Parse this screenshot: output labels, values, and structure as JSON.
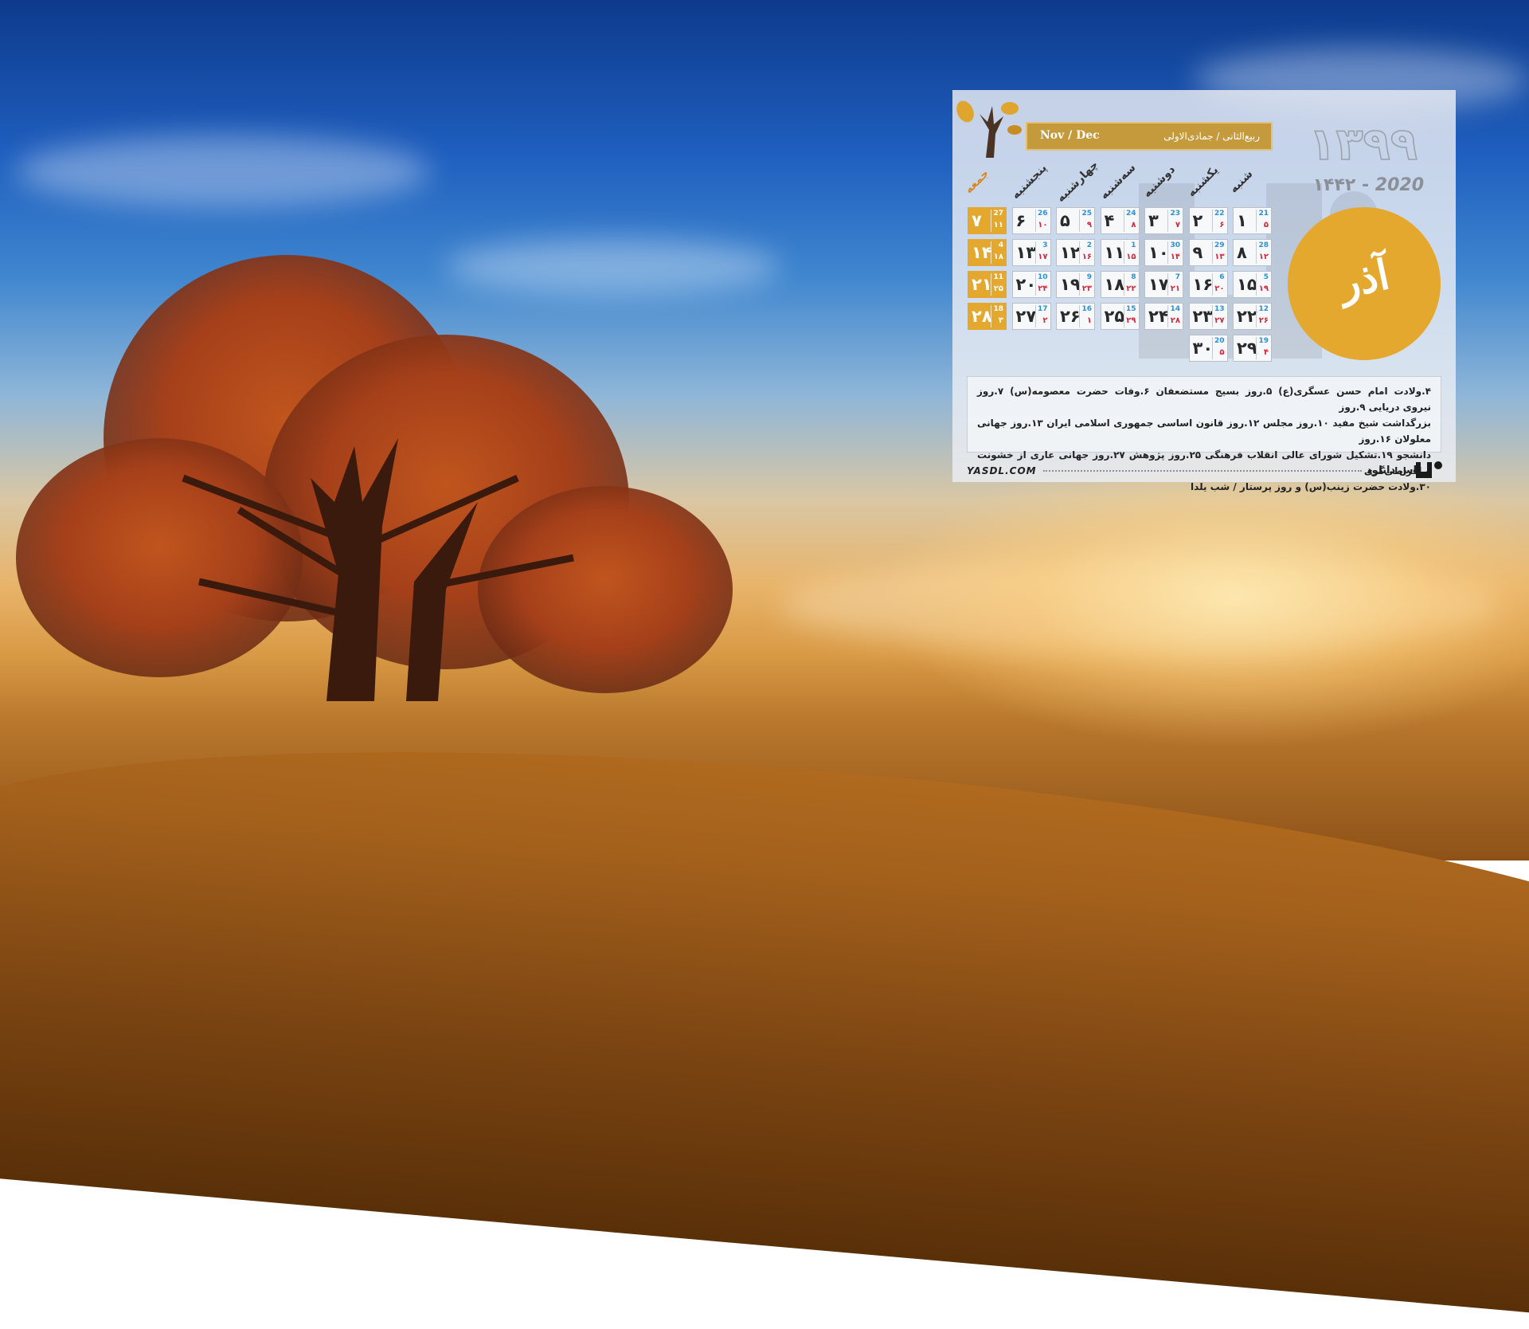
{
  "calendar": {
    "year_persian": "۱۳۹۹",
    "year_line_gregorian": "2020",
    "year_line_separator": " - ",
    "year_line_hijri": "۱۴۴۲",
    "month_name": "آذر",
    "gregorian_months": "Nov / Dec",
    "hijri_months": "ربیع‌الثانی / جمادی‌الاولی",
    "weekday_names": [
      "شنبه",
      "یکشنبه",
      "دوشنبه",
      "سه‌شنبه",
      "چهارشنبه",
      "پنجشنبه",
      "جمعه"
    ],
    "weeks": [
      [
        {
          "d": "۱",
          "g": "21",
          "h": "۵"
        },
        {
          "d": "۲",
          "g": "22",
          "h": "۶"
        },
        {
          "d": "۳",
          "g": "23",
          "h": "۷"
        },
        {
          "d": "۴",
          "g": "24",
          "h": "۸"
        },
        {
          "d": "۵",
          "g": "25",
          "h": "۹"
        },
        {
          "d": "۶",
          "g": "26",
          "h": "۱۰"
        },
        {
          "d": "۷",
          "g": "27",
          "h": "۱۱"
        }
      ],
      [
        {
          "d": "۸",
          "g": "28",
          "h": "۱۲"
        },
        {
          "d": "۹",
          "g": "29",
          "h": "۱۳"
        },
        {
          "d": "۱۰",
          "g": "30",
          "h": "۱۴"
        },
        {
          "d": "۱۱",
          "g": "1",
          "h": "۱۵"
        },
        {
          "d": "۱۲",
          "g": "2",
          "h": "۱۶"
        },
        {
          "d": "۱۳",
          "g": "3",
          "h": "۱۷"
        },
        {
          "d": "۱۴",
          "g": "4",
          "h": "۱۸"
        }
      ],
      [
        {
          "d": "۱۵",
          "g": "5",
          "h": "۱۹"
        },
        {
          "d": "۱۶",
          "g": "6",
          "h": "۲۰"
        },
        {
          "d": "۱۷",
          "g": "7",
          "h": "۲۱"
        },
        {
          "d": "۱۸",
          "g": "8",
          "h": "۲۲"
        },
        {
          "d": "۱۹",
          "g": "9",
          "h": "۲۳"
        },
        {
          "d": "۲۰",
          "g": "10",
          "h": "۲۴"
        },
        {
          "d": "۲۱",
          "g": "11",
          "h": "۲۵"
        }
      ],
      [
        {
          "d": "۲۲",
          "g": "12",
          "h": "۲۶"
        },
        {
          "d": "۲۳",
          "g": "13",
          "h": "۲۷"
        },
        {
          "d": "۲۴",
          "g": "14",
          "h": "۲۸"
        },
        {
          "d": "۲۵",
          "g": "15",
          "h": "۲۹"
        },
        {
          "d": "۲۶",
          "g": "16",
          "h": "۱"
        },
        {
          "d": "۲۷",
          "g": "17",
          "h": "۲"
        },
        {
          "d": "۲۸",
          "g": "18",
          "h": "۳"
        }
      ],
      [
        {
          "d": "۲۹",
          "g": "19",
          "h": "۴"
        },
        {
          "d": "۳۰",
          "g": "20",
          "h": "۵"
        }
      ]
    ],
    "events": [
      "۴.ولادت امام حسن عسگری(ع) ۵.روز بسیج مستضعفان ۶.وفات حضرت معصومه(س) ۷.روز نیروی دریایی ۹.روز",
      "بزرگداشت شیخ مفید ۱۰.روز مجلس ۱۲.روز قانون اساسی جمهوری اسلامی ایران ۱۳.روز جهانی معلولان ۱۶.روز",
      "دانشجو ۱۹.تشکیل شورای عالی انقلاب فرهنگی ۲۵.روز پژوهش ۲۷.روز جهانی عاری از خشونت و افراطی‌گری",
      "۳۰.ولادت حضرت زینب(س) و روز پرستار / شب یلدا"
    ],
    "footer_url": "YASDL.COM",
    "footer_name": "یاس دانلود"
  },
  "colors": {
    "accent": "#e4a82f",
    "banner": "#c49a3c",
    "gregorian": "#2f8fd8",
    "hijri": "#d6273a"
  }
}
